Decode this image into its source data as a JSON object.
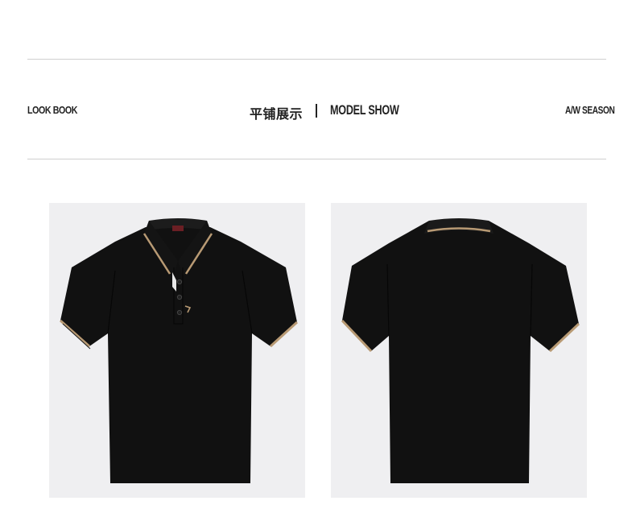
{
  "header": {
    "left_label": "LOOK BOOK",
    "title_cn": "平铺展示",
    "title_en": "MODEL SHOW",
    "right_label": "A/W SEASON"
  },
  "colors": {
    "panel_bg": "#efeff1",
    "shirt": "#111111",
    "trim": "#b89a74",
    "rule": "#cfcfcf"
  },
  "products": [
    {
      "view": "front",
      "icon": "polo-shirt-front-icon"
    },
    {
      "view": "back",
      "icon": "polo-shirt-back-icon"
    }
  ]
}
